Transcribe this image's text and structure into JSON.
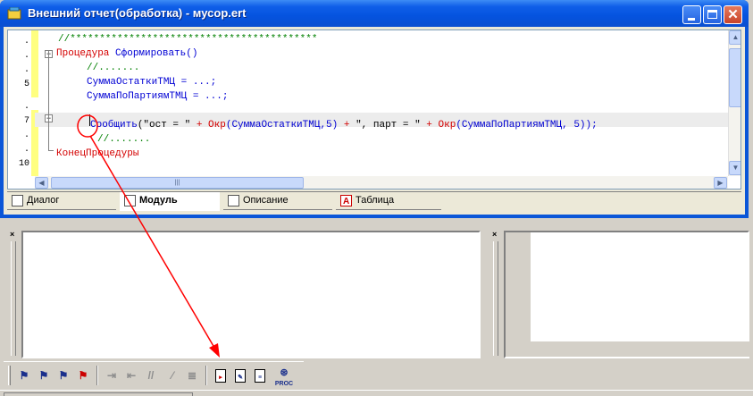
{
  "window": {
    "title": "Внешний отчет(обработка) - мусор.ert"
  },
  "editor": {
    "line_numbers": [
      ".",
      ".",
      ".",
      "5",
      ".",
      "7",
      ".",
      ".",
      "10"
    ],
    "lines": {
      "l1": "//******************************************",
      "l2_kw": "Процедура",
      "l2_name": "Сформировать()",
      "l3": "//.......",
      "l4_id": "СуммаОстаткиТМЦ",
      "l4_rest": " = ...;",
      "l5_id": "СуммаПоПартиямТМЦ",
      "l5_rest": " = ...;",
      "l7_fn": "Сообщить",
      "l7_a": "(\"ост = \" ",
      "l7_b": "+ Окр",
      "l7_c": "(СуммаОстаткиТМЦ,5) ",
      "l7_d": "+ ",
      "l7_e": "\", парт = \" ",
      "l7_f": "+ Окр",
      "l7_g": "(СуммаПоПартиямТМЦ, 5));",
      "l8": "//.......",
      "l9": "КонецПроцедуры"
    }
  },
  "tabs": [
    {
      "label": "Диалог",
      "active": false
    },
    {
      "label": "Модуль",
      "active": true
    },
    {
      "label": "Описание",
      "active": false
    },
    {
      "label": "Таблица",
      "active": false
    }
  ],
  "colors": {
    "keyword": "#d40000",
    "identifier": "#0000d4",
    "comment": "#008000",
    "annotation": "#ff0000"
  },
  "toolbar": {
    "icons": [
      "bookmark-set-icon",
      "bookmark-next-icon",
      "bookmark-prev-icon",
      "bookmark-clear-icon",
      "indent-icon",
      "outdent-icon",
      "comment-icon",
      "uncomment-icon",
      "format-icon",
      "syntax-check-icon",
      "module-edit-icon",
      "procedure-list-icon",
      "find-procedure-icon"
    ],
    "proc_label": "PROC"
  }
}
